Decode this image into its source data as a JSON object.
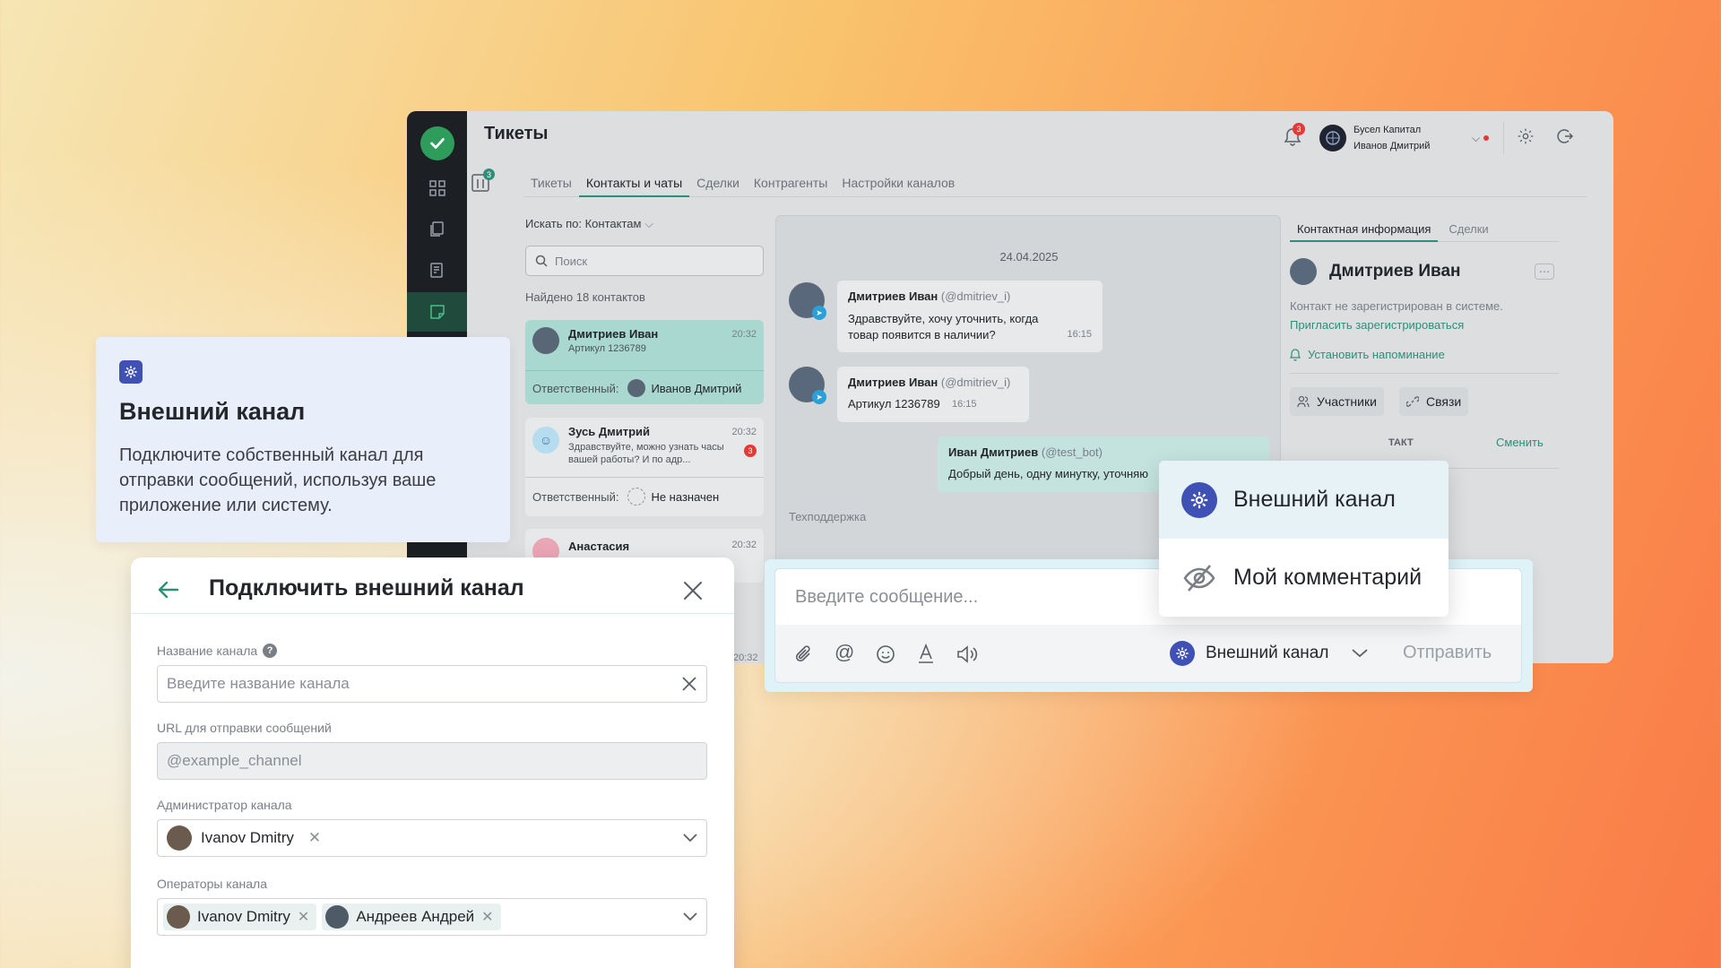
{
  "app": {
    "title": "Тикеты",
    "notif_count": "3",
    "account_company": "Бусел Капитал",
    "account_user": "Иванов Дмитрий",
    "rail_badge": "3",
    "tabs": [
      {
        "label": "Тикеты",
        "active": false
      },
      {
        "label": "Контакты и чаты",
        "active": true
      },
      {
        "label": "Сделки",
        "active": false
      },
      {
        "label": "Контрагенты",
        "active": false
      },
      {
        "label": "Настройки каналов",
        "active": false
      }
    ],
    "search_by": "Искать по: Контактам",
    "search_placeholder": "Поиск",
    "found_text": "Найдено 18 контактов",
    "contacts": [
      {
        "name": "Дмитриев Иван",
        "sub": "Артикул 1236789",
        "time": "20:32",
        "resp_label": "Ответственный:",
        "resp_name": "Иванов Дмитрий"
      },
      {
        "name": "Зусь Дмитрий",
        "sub": "Здравствуйте, можно узнать часы вашей работы? И по адр...",
        "time": "20:32",
        "badge": "3",
        "resp_label": "Ответственный:",
        "resp_name": "Не назначен"
      },
      {
        "name": "Анастасия",
        "time": "20:32"
      }
    ],
    "extra_time": "20:32",
    "chat": {
      "date": "24.04.2025",
      "messages": [
        {
          "author": "Дмитриев Иван",
          "handle": "(@dmitriev_i)",
          "text": "Здравствуйте, хочу уточнить, когда товар появится в наличии?",
          "time": "16:15"
        },
        {
          "author": "Дмитриев Иван",
          "handle": "(@dmitriev_i)",
          "text": "Артикул 1236789",
          "time": "16:15"
        },
        {
          "author": "Иван Дмитриев",
          "handle": "(@test_bot)",
          "text": "Добрый день, одну минутку, уточняю"
        }
      ],
      "footer_label": "Техподдержка"
    },
    "right": {
      "tabs": [
        {
          "label": "Контактная информация",
          "active": true
        },
        {
          "label": "Сделки",
          "active": false
        }
      ],
      "contact_name": "Дмитриев Иван",
      "not_registered": "Контакт не зарегистрирован в системе.",
      "invite_link": "Пригласить зарегистрироваться",
      "reminder": "Установить напоминание",
      "participants": "Участники",
      "links": "Связи",
      "contact_type_fragment": "ТАКТ",
      "change_link": "Сменить"
    }
  },
  "info_card": {
    "title": "Внешний канал",
    "description": "Подключите собственный канал для отправки сообщений, используя ваше приложение или систему."
  },
  "modal": {
    "title": "Подключить внешний канал",
    "channel_name_label": "Название канала",
    "channel_name_placeholder": "Введите название канала",
    "url_label": "URL для отправки сообщений",
    "url_placeholder": "@example_channel",
    "admin_label": "Администратор канала",
    "admin_chip": "Ivanov Dmitry",
    "operators_label": "Операторы канала",
    "operator_chips": [
      "Ivanov Dmitry",
      "Андреев Андрей"
    ]
  },
  "composer": {
    "placeholder": "Введите сообщение...",
    "channel_selected": "Внешний канал",
    "send_label": "Отправить"
  },
  "channel_menu": {
    "items": [
      {
        "label": "Внешний канал",
        "icon": "gear-icon",
        "selected": true
      },
      {
        "label": "Мой комментарий",
        "icon": "eye-off-icon",
        "selected": false
      }
    ]
  },
  "colors": {
    "accent_teal": "#2d8f79",
    "channel_blue": "#3f51b5",
    "badge_red": "#e53935",
    "brand_green": "#2e9c5b"
  }
}
